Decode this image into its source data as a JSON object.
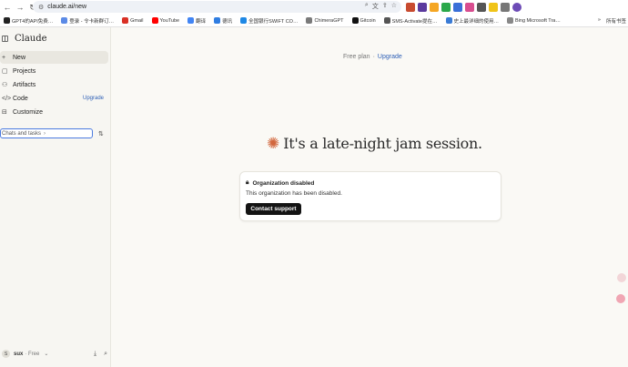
{
  "browser": {
    "url": "claude.ai/new",
    "bookmarks": [
      {
        "label": "GPT4的API免费…",
        "color": "#222"
      },
      {
        "label": "登录 - 令卡新群订…",
        "color": "#5b8ae6"
      },
      {
        "label": "Gmail",
        "color": "#d93025"
      },
      {
        "label": "YouTube",
        "color": "#ff0000"
      },
      {
        "label": "翻译",
        "color": "#4285f4"
      },
      {
        "label": "德讯",
        "color": "#2f7de1"
      },
      {
        "label": "全国银行SWIFT CO…",
        "color": "#1e88e5"
      },
      {
        "label": "ChimeraGPT",
        "color": "#7a7a7a"
      },
      {
        "label": "Gitcoin",
        "color": "#111"
      },
      {
        "label": "SMS-Activate提在…",
        "color": "#555"
      },
      {
        "label": "史上最详细的使用…",
        "color": "#3a7bd5"
      },
      {
        "label": "Bing Microsoft Tra…",
        "color": "#888"
      }
    ],
    "bookmarks_more": "»",
    "all_bookmarks": "所有书签"
  },
  "sidebar": {
    "logo": "Claude",
    "items": [
      {
        "label": "New",
        "icon": "plus-icon",
        "active": true
      },
      {
        "label": "Projects",
        "icon": "projects-icon"
      },
      {
        "label": "Artifacts",
        "icon": "artifacts-icon"
      },
      {
        "label": "Code",
        "icon": "code-icon",
        "badge": "Upgrade"
      },
      {
        "label": "Customize",
        "icon": "customize-icon"
      }
    ],
    "search": "Chats and tasks",
    "user": {
      "initial": "S",
      "name": "sux",
      "plan": "Free"
    }
  },
  "main": {
    "plan_label": "Free plan",
    "separator": "·",
    "upgrade": "Upgrade",
    "greeting": "It's a late-night jam session.",
    "card": {
      "title": "Organization disabled",
      "message": "This organization has been disabled.",
      "button": "Contact support"
    }
  },
  "colors": {
    "accent": "#d2673d",
    "link": "#2d5fb6",
    "button": "#141414"
  }
}
